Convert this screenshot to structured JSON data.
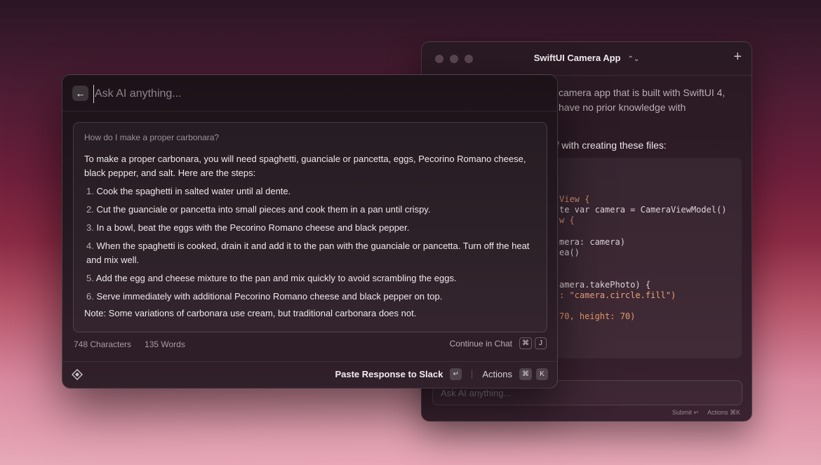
{
  "back_window": {
    "title": "SwiftUI Camera App",
    "title_chevron": "⌃⌄",
    "new_icon": "+",
    "intro_text": "camera app that is built with SwiftUI 4, have no prior knowledge with",
    "files_text": "ff with creating these files:",
    "code_lines": [
      "View {",
      "te var camera = CameraViewModel()",
      "w {",
      "mera: camera)",
      "ea()",
      "amera.takePhoto) {",
      ": \"camera.circle.fill\")",
      "70, height: 70)"
    ],
    "input_placeholder": "Ask AI anything...",
    "footer_submit": "Submit ↵",
    "footer_actions": "Actions ⌘K"
  },
  "front_window": {
    "search_placeholder": "Ask AI anything...",
    "question": "How do I make a proper carbonara?",
    "intro": "To make a proper carbonara, you will need spaghetti, guanciale or pancetta, eggs, Pecorino Romano cheese, black pepper, and salt. Here are the steps:",
    "steps": [
      {
        "n": "1.",
        "text": "Cook the spaghetti in salted water until al dente."
      },
      {
        "n": "2.",
        "text": "Cut the guanciale or pancetta into small pieces and cook them in a pan until crispy."
      },
      {
        "n": "3.",
        "text": "In a bowl, beat the eggs with the Pecorino Romano cheese and black pepper."
      },
      {
        "n": "4.",
        "text": "When the spaghetti is cooked, drain it and add it to the pan with the guanciale or pancetta. Turn off the heat and mix well."
      },
      {
        "n": "5.",
        "text": "Add the egg and cheese mixture to the pan and mix quickly to avoid scrambling the eggs."
      },
      {
        "n": "6.",
        "text": "Serve immediately with additional Pecorino Romano cheese and black pepper on top."
      }
    ],
    "note": "Note: Some variations of carbonara use cream, but traditional carbonara does not.",
    "characters": "748 Characters",
    "words": "135 Words",
    "continue_label": "Continue in Chat",
    "continue_key_cmd": "⌘",
    "continue_key_j": "J",
    "paste_label": "Paste Response to Slack",
    "paste_key": "↵",
    "actions_label": "Actions",
    "actions_key_cmd": "⌘",
    "actions_key_k": "K"
  }
}
